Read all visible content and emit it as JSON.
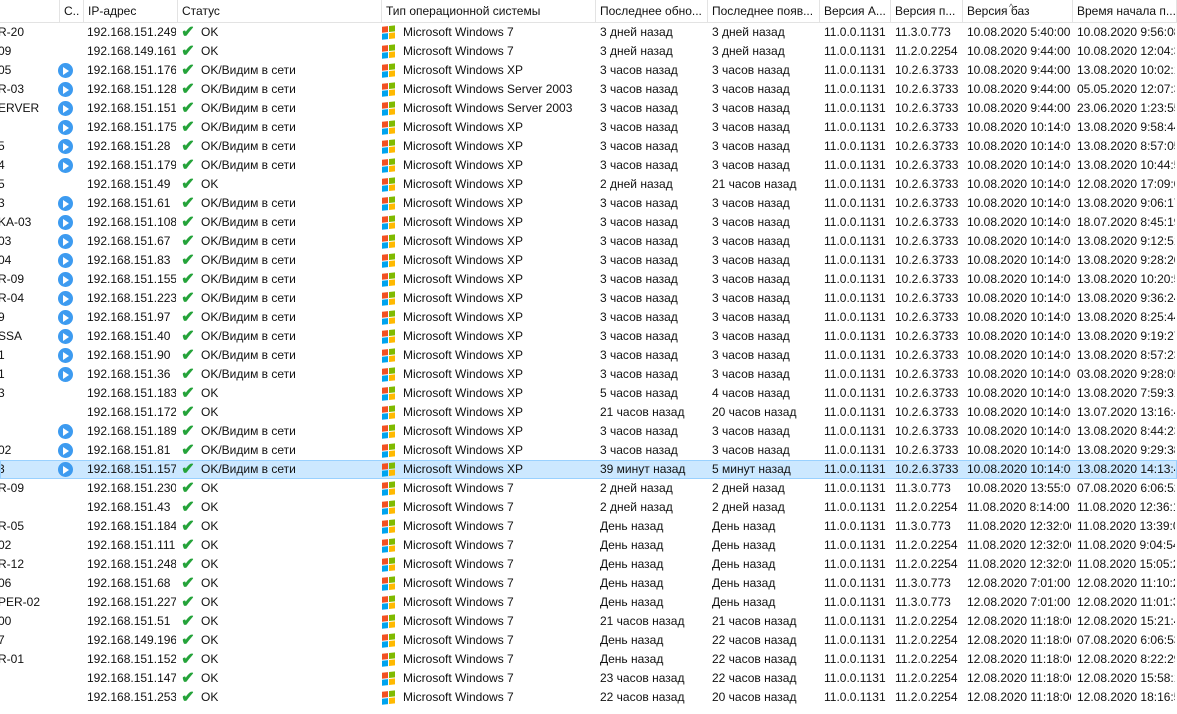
{
  "headers": {
    "name": "",
    "state": "С..",
    "ip": "IP-адрес",
    "status": "Статус",
    "os": "Тип операционной системы",
    "last_update": "Последнее обно...",
    "last_seen": "Последнее появ...",
    "agent_ver": "Версия А...",
    "prod_ver": "Версия п...",
    "db_ver": "Версия баз",
    "start_time": "Время начала п..."
  },
  "icons": {
    "status_ok": "check-icon",
    "state": "play-icon",
    "os": "windows-logo-icon"
  },
  "colors": {
    "check": "#25a33a",
    "play": "#3d9bf0",
    "selected_row": "#cce8ff"
  },
  "selected_row_index": 23,
  "rows": [
    {
      "name": "R-20",
      "play": false,
      "ip": "192.168.151.249",
      "status": "OK",
      "os": "Microsoft Windows 7",
      "upd": "3 дней назад",
      "seen": "3 дней назад",
      "agent": "11.0.0.1131",
      "prod": "11.3.0.773",
      "db": "10.08.2020 5:40:00",
      "start": "10.08.2020 9:56:08"
    },
    {
      "name": "09",
      "play": false,
      "ip": "192.168.149.161",
      "status": "OK",
      "os": "Microsoft Windows 7",
      "upd": "3 дней назад",
      "seen": "3 дней назад",
      "agent": "11.0.0.1131",
      "prod": "11.2.0.2254",
      "db": "10.08.2020 9:44:00",
      "start": "10.08.2020 12:04:3"
    },
    {
      "name": "05",
      "play": true,
      "ip": "192.168.151.176",
      "status": "OK/Видим в сети",
      "os": "Microsoft Windows XP",
      "upd": "3 часов назад",
      "seen": "3 часов назад",
      "agent": "11.0.0.1131",
      "prod": "10.2.6.3733",
      "db": "10.08.2020 9:44:00",
      "start": "13.08.2020 10:02:1"
    },
    {
      "name": "R-03",
      "play": true,
      "ip": "192.168.151.128",
      "status": "OK/Видим в сети",
      "os": "Microsoft Windows Server 2003",
      "upd": "3 часов назад",
      "seen": "3 часов назад",
      "agent": "11.0.0.1131",
      "prod": "10.2.6.3733",
      "db": "10.08.2020 9:44:00",
      "start": "05.05.2020 12:07:3"
    },
    {
      "name": "ERVER",
      "play": true,
      "ip": "192.168.151.151",
      "status": "OK/Видим в сети",
      "os": "Microsoft Windows Server 2003",
      "upd": "3 часов назад",
      "seen": "3 часов назад",
      "agent": "11.0.0.1131",
      "prod": "10.2.6.3733",
      "db": "10.08.2020 9:44:00",
      "start": "23.06.2020 1:23:55"
    },
    {
      "name": "",
      "play": true,
      "ip": "192.168.151.175",
      "status": "OK/Видим в сети",
      "os": "Microsoft Windows XP",
      "upd": "3 часов назад",
      "seen": "3 часов назад",
      "agent": "11.0.0.1131",
      "prod": "10.2.6.3733",
      "db": "10.08.2020 10:14:00",
      "start": "13.08.2020 9:58:44"
    },
    {
      "name": "5",
      "play": true,
      "ip": "192.168.151.28",
      "status": "OK/Видим в сети",
      "os": "Microsoft Windows XP",
      "upd": "3 часов назад",
      "seen": "3 часов назад",
      "agent": "11.0.0.1131",
      "prod": "10.2.6.3733",
      "db": "10.08.2020 10:14:00",
      "start": "13.08.2020 8:57:05"
    },
    {
      "name": "4",
      "play": true,
      "ip": "192.168.151.179",
      "status": "OK/Видим в сети",
      "os": "Microsoft Windows XP",
      "upd": "3 часов назад",
      "seen": "3 часов назад",
      "agent": "11.0.0.1131",
      "prod": "10.2.6.3733",
      "db": "10.08.2020 10:14:00",
      "start": "13.08.2020 10:44:5"
    },
    {
      "name": "5",
      "play": false,
      "ip": "192.168.151.49",
      "status": "OK",
      "os": "Microsoft Windows XP",
      "upd": "2 дней назад",
      "seen": "21 часов назад",
      "agent": "11.0.0.1131",
      "prod": "10.2.6.3733",
      "db": "10.08.2020 10:14:00",
      "start": "12.08.2020 17:09:0"
    },
    {
      "name": "3",
      "play": true,
      "ip": "192.168.151.61",
      "status": "OK/Видим в сети",
      "os": "Microsoft Windows XP",
      "upd": "3 часов назад",
      "seen": "3 часов назад",
      "agent": "11.0.0.1131",
      "prod": "10.2.6.3733",
      "db": "10.08.2020 10:14:00",
      "start": "13.08.2020 9:06:17"
    },
    {
      "name": "KA-03",
      "play": true,
      "ip": "192.168.151.108",
      "status": "OK/Видим в сети",
      "os": "Microsoft Windows XP",
      "upd": "3 часов назад",
      "seen": "3 часов назад",
      "agent": "11.0.0.1131",
      "prod": "10.2.6.3733",
      "db": "10.08.2020 10:14:00",
      "start": "18.07.2020 8:45:19"
    },
    {
      "name": "03",
      "play": true,
      "ip": "192.168.151.67",
      "status": "OK/Видим в сети",
      "os": "Microsoft Windows XP",
      "upd": "3 часов назад",
      "seen": "3 часов назад",
      "agent": "11.0.0.1131",
      "prod": "10.2.6.3733",
      "db": "10.08.2020 10:14:00",
      "start": "13.08.2020 9:12:51"
    },
    {
      "name": "04",
      "play": true,
      "ip": "192.168.151.83",
      "status": "OK/Видим в сети",
      "os": "Microsoft Windows XP",
      "upd": "3 часов назад",
      "seen": "3 часов назад",
      "agent": "11.0.0.1131",
      "prod": "10.2.6.3733",
      "db": "10.08.2020 10:14:00",
      "start": "13.08.2020 9:28:20"
    },
    {
      "name": "R-09",
      "play": true,
      "ip": "192.168.151.155",
      "status": "OK/Видим в сети",
      "os": "Microsoft Windows XP",
      "upd": "3 часов назад",
      "seen": "3 часов назад",
      "agent": "11.0.0.1131",
      "prod": "10.2.6.3733",
      "db": "10.08.2020 10:14:00",
      "start": "13.08.2020 10:20:5"
    },
    {
      "name": "R-04",
      "play": true,
      "ip": "192.168.151.223",
      "status": "OK/Видим в сети",
      "os": "Microsoft Windows XP",
      "upd": "3 часов назад",
      "seen": "3 часов назад",
      "agent": "11.0.0.1131",
      "prod": "10.2.6.3733",
      "db": "10.08.2020 10:14:00",
      "start": "13.08.2020 9:36:24"
    },
    {
      "name": "9",
      "play": true,
      "ip": "192.168.151.97",
      "status": "OK/Видим в сети",
      "os": "Microsoft Windows XP",
      "upd": "3 часов назад",
      "seen": "3 часов назад",
      "agent": "11.0.0.1131",
      "prod": "10.2.6.3733",
      "db": "10.08.2020 10:14:00",
      "start": "13.08.2020 8:25:44"
    },
    {
      "name": "SSA",
      "play": true,
      "ip": "192.168.151.40",
      "status": "OK/Видим в сети",
      "os": "Microsoft Windows XP",
      "upd": "3 часов назад",
      "seen": "3 часов назад",
      "agent": "11.0.0.1131",
      "prod": "10.2.6.3733",
      "db": "10.08.2020 10:14:00",
      "start": "13.08.2020 9:19:27"
    },
    {
      "name": "1",
      "play": true,
      "ip": "192.168.151.90",
      "status": "OK/Видим в сети",
      "os": "Microsoft Windows XP",
      "upd": "3 часов назад",
      "seen": "3 часов назад",
      "agent": "11.0.0.1131",
      "prod": "10.2.6.3733",
      "db": "10.08.2020 10:14:00",
      "start": "13.08.2020 8:57:23"
    },
    {
      "name": "1",
      "play": true,
      "ip": "192.168.151.36",
      "status": "OK/Видим в сети",
      "os": "Microsoft Windows XP",
      "upd": "3 часов назад",
      "seen": "3 часов назад",
      "agent": "11.0.0.1131",
      "prod": "10.2.6.3733",
      "db": "10.08.2020 10:14:00",
      "start": "03.08.2020 9:28:05"
    },
    {
      "name": "3",
      "play": false,
      "ip": "192.168.151.183",
      "status": "OK",
      "os": "Microsoft Windows XP",
      "upd": "5 часов назад",
      "seen": "4 часов назад",
      "agent": "11.0.0.1131",
      "prod": "10.2.6.3733",
      "db": "10.08.2020 10:14:00",
      "start": "13.08.2020 7:59:31"
    },
    {
      "name": "",
      "play": false,
      "ip": "192.168.151.172",
      "status": "OK",
      "os": "Microsoft Windows XP",
      "upd": "21 часов назад",
      "seen": "20 часов назад",
      "agent": "11.0.0.1131",
      "prod": "10.2.6.3733",
      "db": "10.08.2020 10:14:00",
      "start": "13.07.2020 13:16:4"
    },
    {
      "name": "",
      "play": true,
      "ip": "192.168.151.189",
      "status": "OK/Видим в сети",
      "os": "Microsoft Windows XP",
      "upd": "3 часов назад",
      "seen": "3 часов назад",
      "agent": "11.0.0.1131",
      "prod": "10.2.6.3733",
      "db": "10.08.2020 10:14:00",
      "start": "13.08.2020 8:44:23"
    },
    {
      "name": "02",
      "play": true,
      "ip": "192.168.151.81",
      "status": "OK/Видим в сети",
      "os": "Microsoft Windows XP",
      "upd": "3 часов назад",
      "seen": "3 часов назад",
      "agent": "11.0.0.1131",
      "prod": "10.2.6.3733",
      "db": "10.08.2020 10:14:00",
      "start": "13.08.2020 9:29:38"
    },
    {
      "name": "3",
      "play": true,
      "ip": "192.168.151.157",
      "status": "OK/Видим в сети",
      "os": "Microsoft Windows XP",
      "upd": "39 минут назад",
      "seen": "5 минут назад",
      "agent": "11.0.0.1131",
      "prod": "10.2.6.3733",
      "db": "10.08.2020 10:14:00",
      "start": "13.08.2020 14:13:4"
    },
    {
      "name": "R-09",
      "play": false,
      "ip": "192.168.151.230",
      "status": "OK",
      "os": "Microsoft Windows 7",
      "upd": "2 дней назад",
      "seen": "2 дней назад",
      "agent": "11.0.0.1131",
      "prod": "11.3.0.773",
      "db": "10.08.2020 13:55:00",
      "start": "07.08.2020 6:06:52"
    },
    {
      "name": "",
      "play": false,
      "ip": "192.168.151.43",
      "status": "OK",
      "os": "Microsoft Windows 7",
      "upd": "2 дней назад",
      "seen": "2 дней назад",
      "agent": "11.0.0.1131",
      "prod": "11.2.0.2254",
      "db": "11.08.2020 8:14:00",
      "start": "11.08.2020 12:36:1"
    },
    {
      "name": "R-05",
      "play": false,
      "ip": "192.168.151.184",
      "status": "OK",
      "os": "Microsoft Windows 7",
      "upd": "День назад",
      "seen": "День назад",
      "agent": "11.0.0.1131",
      "prod": "11.3.0.773",
      "db": "11.08.2020 12:32:00",
      "start": "11.08.2020 13:39:0"
    },
    {
      "name": "02",
      "play": false,
      "ip": "192.168.151.111",
      "status": "OK",
      "os": "Microsoft Windows 7",
      "upd": "День назад",
      "seen": "День назад",
      "agent": "11.0.0.1131",
      "prod": "11.2.0.2254",
      "db": "11.08.2020 12:32:00",
      "start": "11.08.2020 9:04:54"
    },
    {
      "name": "R-12",
      "play": false,
      "ip": "192.168.151.248",
      "status": "OK",
      "os": "Microsoft Windows 7",
      "upd": "День назад",
      "seen": "День назад",
      "agent": "11.0.0.1131",
      "prod": "11.2.0.2254",
      "db": "11.08.2020 12:32:00",
      "start": "11.08.2020 15:05:2"
    },
    {
      "name": "06",
      "play": false,
      "ip": "192.168.151.68",
      "status": "OK",
      "os": "Microsoft Windows 7",
      "upd": "День назад",
      "seen": "День назад",
      "agent": "11.0.0.1131",
      "prod": "11.3.0.773",
      "db": "12.08.2020 7:01:00",
      "start": "12.08.2020 11:10:2"
    },
    {
      "name": "PER-02",
      "play": false,
      "ip": "192.168.151.227",
      "status": "OK",
      "os": "Microsoft Windows 7",
      "upd": "День назад",
      "seen": "День назад",
      "agent": "11.0.0.1131",
      "prod": "11.3.0.773",
      "db": "12.08.2020 7:01:00",
      "start": "12.08.2020 11:01:3"
    },
    {
      "name": "00",
      "play": false,
      "ip": "192.168.151.51",
      "status": "OK",
      "os": "Microsoft Windows 7",
      "upd": "21 часов назад",
      "seen": "21 часов назад",
      "agent": "11.0.0.1131",
      "prod": "11.2.0.2254",
      "db": "12.08.2020 11:18:00",
      "start": "12.08.2020 15:21:4"
    },
    {
      "name": "7",
      "play": false,
      "ip": "192.168.149.196",
      "status": "OK",
      "os": "Microsoft Windows 7",
      "upd": "День назад",
      "seen": "22 часов назад",
      "agent": "11.0.0.1131",
      "prod": "11.2.0.2254",
      "db": "12.08.2020 11:18:00",
      "start": "07.08.2020 6:06:53"
    },
    {
      "name": "R-01",
      "play": false,
      "ip": "192.168.151.152",
      "status": "OK",
      "os": "Microsoft Windows 7",
      "upd": "День назад",
      "seen": "22 часов назад",
      "agent": "11.0.0.1131",
      "prod": "11.2.0.2254",
      "db": "12.08.2020 11:18:00",
      "start": "12.08.2020 8:22:29"
    },
    {
      "name": "",
      "play": false,
      "ip": "192.168.151.147",
      "status": "OK",
      "os": "Microsoft Windows 7",
      "upd": "23 часов назад",
      "seen": "22 часов назад",
      "agent": "11.0.0.1131",
      "prod": "11.2.0.2254",
      "db": "12.08.2020 11:18:00",
      "start": "12.08.2020 15:58:1"
    },
    {
      "name": "",
      "play": false,
      "ip": "192.168.151.253",
      "status": "OK",
      "os": "Microsoft Windows 7",
      "upd": "22 часов назад",
      "seen": "20 часов назад",
      "agent": "11.0.0.1131",
      "prod": "11.2.0.2254",
      "db": "12.08.2020 11:18:00",
      "start": "12.08.2020 18:16:5"
    }
  ]
}
